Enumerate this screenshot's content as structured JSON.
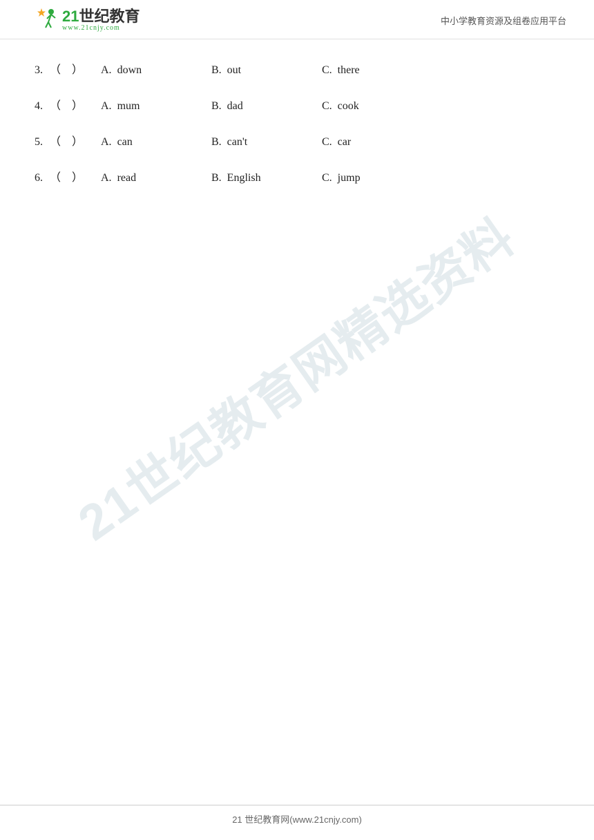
{
  "header": {
    "logo_number": "21",
    "logo_name": "世纪教育",
    "logo_url": "www.21cnjy.com",
    "platform_name": "中小学教育资源及组卷应用平台"
  },
  "quiz": {
    "items": [
      {
        "number": "3.",
        "bracket": "（    ）",
        "optionA_label": "A.",
        "optionA_text": "down",
        "optionB_label": "B.",
        "optionB_text": "out",
        "optionC_label": "C.",
        "optionC_text": "there"
      },
      {
        "number": "4.",
        "bracket": "（    ）",
        "optionA_label": "A.",
        "optionA_text": "mum",
        "optionB_label": "B.",
        "optionB_text": "dad",
        "optionC_label": "C.",
        "optionC_text": "cook"
      },
      {
        "number": "5.",
        "bracket": "（    ）",
        "optionA_label": "A.",
        "optionA_text": "can",
        "optionB_label": "B.",
        "optionB_text": "can't",
        "optionC_label": "C.",
        "optionC_text": "car"
      },
      {
        "number": "6.",
        "bracket": "（    ）",
        "optionA_label": "A.",
        "optionA_text": "read",
        "optionB_label": "B.",
        "optionB_text": "English",
        "optionC_label": "C.",
        "optionC_text": "jump"
      }
    ]
  },
  "watermark": {
    "line1": "21世纪教育网精选资料"
  },
  "footer": {
    "text": "21 世纪教育网(www.21cnjy.com)"
  }
}
